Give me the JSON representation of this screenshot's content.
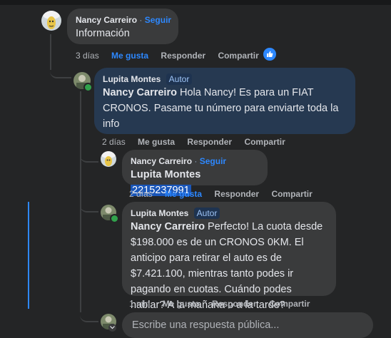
{
  "comments": [
    {
      "author": "Nancy Carreiro",
      "separator": "·",
      "follow_label": "Seguir",
      "text": "Información",
      "time": "3 días",
      "like_label": "Me gusta",
      "reply_label": "Responder",
      "share_label": "Compartir",
      "liked": true,
      "reaction_icon": "like-icon"
    },
    {
      "author": "Lupita Montes",
      "badge": "Autor",
      "mention": "Nancy Carreiro",
      "text": " Hola Nancy! Es para un FIAT CRONOS. Pasame tu número para enviarte toda la info",
      "time": "2 días",
      "like_label": "Me gusta",
      "reply_label": "Responder",
      "share_label": "Compartir"
    },
    {
      "author": "Nancy Carreiro",
      "separator": "·",
      "follow_label": "Seguir",
      "mention": "Lupita Montes",
      "phone": "2215237991",
      "time": "2 días",
      "like_label": "Me gusta",
      "reply_label": "Responder",
      "share_label": "Compartir",
      "liked": true
    },
    {
      "author": "Lupita Montes",
      "badge": "Autor",
      "mention": "Nancy Carreiro",
      "text": " Perfecto! La cuota desde $198.000 es de un CRONOS 0KM. El anticipo para retirar el auto es de $7.421.100, mientras tanto podes ir pagando en cuotas. Cuándo podes hablar? A la mañana o a la tarde?",
      "time": "1 min",
      "like_label": "Me gusta",
      "reply_label": "Responder",
      "share_label": "Compartir"
    }
  ],
  "reply": {
    "placeholder": "Escribe una respuesta pública..."
  },
  "colors": {
    "background": "#242526",
    "bubble": "#3a3b3c",
    "author_bubble": "#263951",
    "accent": "#2d88ff"
  }
}
